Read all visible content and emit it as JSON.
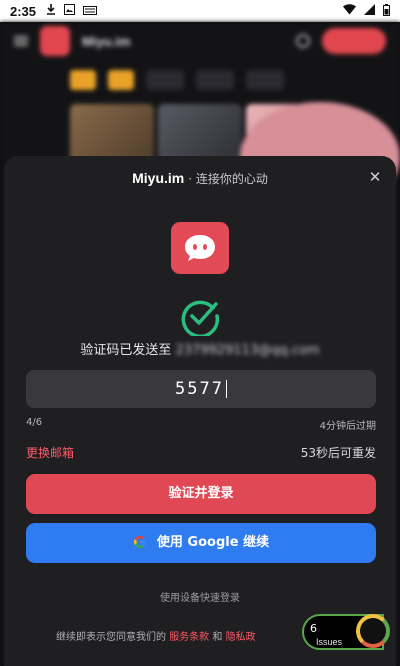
{
  "status_bar": {
    "time": "2:35",
    "icons": [
      "download-icon",
      "image-icon",
      "keyboard-icon",
      "wifi-icon",
      "signal-icon",
      "battery-icon"
    ]
  },
  "background_app": {
    "brand": "Miyu.im"
  },
  "sheet": {
    "brand": "Miyu.im",
    "tagline": "· 连接你的心动",
    "sent_prefix": "验证码已发送至",
    "sent_email": "2379929113@qq.com",
    "code_value": "5577",
    "code_count": "4/6",
    "expire_text": "4分钟后过期",
    "change_email": "更换邮箱",
    "resend_text": "53秒后可重发",
    "verify_button": "验证并登录",
    "google_button": "使用 Google 继续",
    "quick_login": "使用设备快速登录",
    "terms_prefix": "继续即表示您同意我们的",
    "terms_link": "服务条款",
    "terms_and": "和",
    "privacy_link": "隐私政"
  },
  "issues_widget": {
    "count": "6",
    "label": "Issues"
  },
  "colors": {
    "accent": "#e04856",
    "google": "#2f7bf0",
    "check": "#2bbf7f",
    "sheet_bg": "#1f1f22"
  }
}
